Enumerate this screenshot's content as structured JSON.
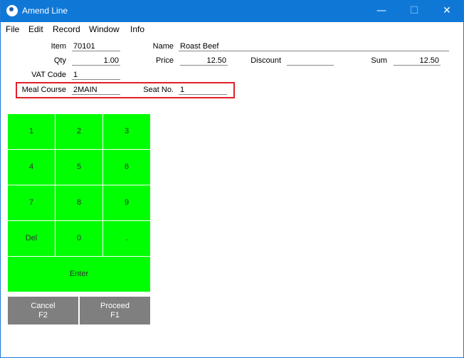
{
  "window": {
    "title": "Amend Line",
    "controls": {
      "minimize": "—",
      "maximize": "☐",
      "close": "✕"
    }
  },
  "menu": [
    "File",
    "Edit",
    "Record",
    "Window",
    "Info"
  ],
  "form": {
    "item_label": "Item",
    "item_value": "70101",
    "name_label": "Name",
    "name_value": "Roast Beef",
    "qty_label": "Qty",
    "qty_value": "1.00",
    "price_label": "Price",
    "price_value": "12.50",
    "discount_label": "Discount",
    "discount_value": "",
    "sum_label": "Sum",
    "sum_value": "12.50",
    "vat_label": "VAT Code",
    "vat_value": "1",
    "meal_label": "Meal Course",
    "meal_value": "2MAIN",
    "seat_label": "Seat No.",
    "seat_value": "1"
  },
  "keypad": {
    "k1": "1",
    "k2": "2",
    "k3": "3",
    "k4": "4",
    "k5": "5",
    "k6": "6",
    "k7": "7",
    "k8": "8",
    "k9": "9",
    "del": "Del",
    "k0": "0",
    "dot": ".",
    "enter": "Enter",
    "cancel_line1": "Cancel",
    "cancel_line2": "F2",
    "proceed_line1": "Proceed",
    "proceed_line2": "F1"
  },
  "colors": {
    "titlebar": "#0f78d7",
    "keypad_green": "#00ff00",
    "action_gray": "#7f7f7f",
    "highlight_red": "#e0202a"
  }
}
